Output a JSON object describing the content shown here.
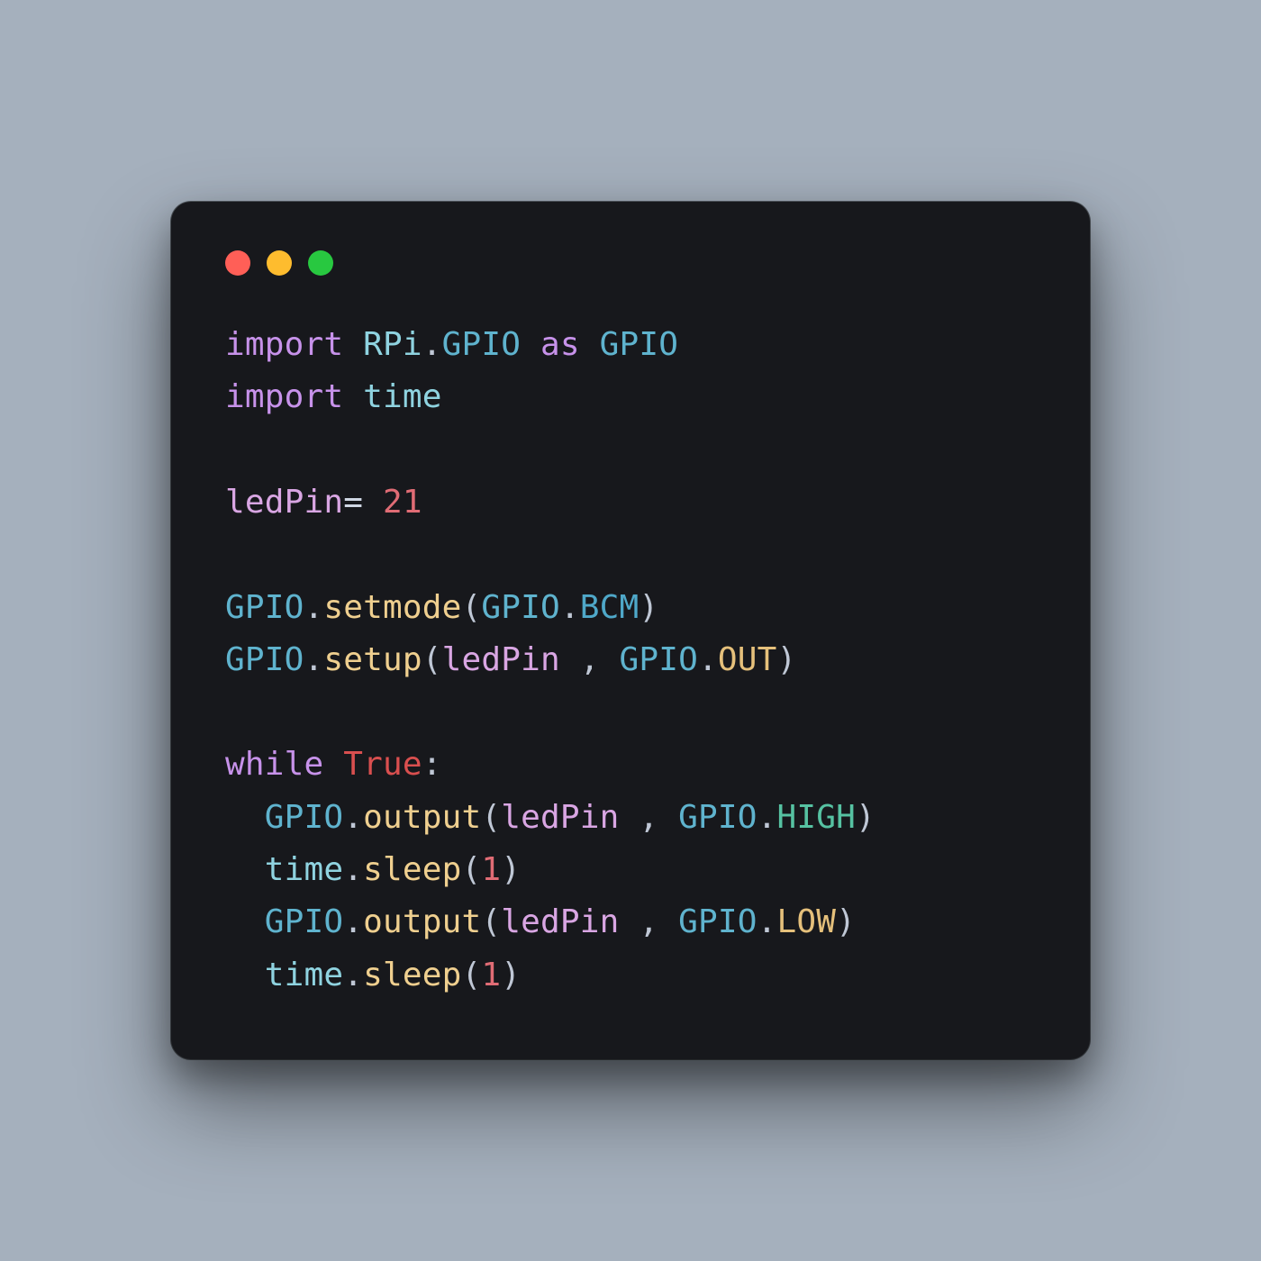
{
  "window": {
    "controls": {
      "close": "close",
      "min": "minimize",
      "zoom": "zoom"
    }
  },
  "t": {
    "import": "import",
    "as": "as",
    "while": "while",
    "RPi": "RPi",
    "GPIO": "GPIO",
    "time": "time",
    "ledPin": "ledPin",
    "eq": "=",
    "n21": "21",
    "setmode": "setmode",
    "BCM": "BCM",
    "setup": "setup",
    "OUT": "OUT",
    "True": "True",
    "colon": ":",
    "output": "output",
    "HIGH": "HIGH",
    "LOW": "LOW",
    "sleep": "sleep",
    "n1": "1",
    "lp": "(",
    "rp": ")",
    "dot": ".",
    "comma_sp": " , "
  },
  "colors": {
    "bg": "#a5b0bd",
    "window": "#17181c",
    "keyword": "#c792ea",
    "module": "#8fd3e0",
    "gpio": "#5fb3ce",
    "attr": "#efcf8f",
    "var": "#d9a6e3",
    "num": "#e06c75",
    "bool": "#d94f4f",
    "constHigh": "#56c2a2",
    "constLowOut": "#e5c07b",
    "punc": "#bfc7d5",
    "close": "#ff5f57",
    "min": "#febc2e",
    "zoom": "#28c840"
  }
}
